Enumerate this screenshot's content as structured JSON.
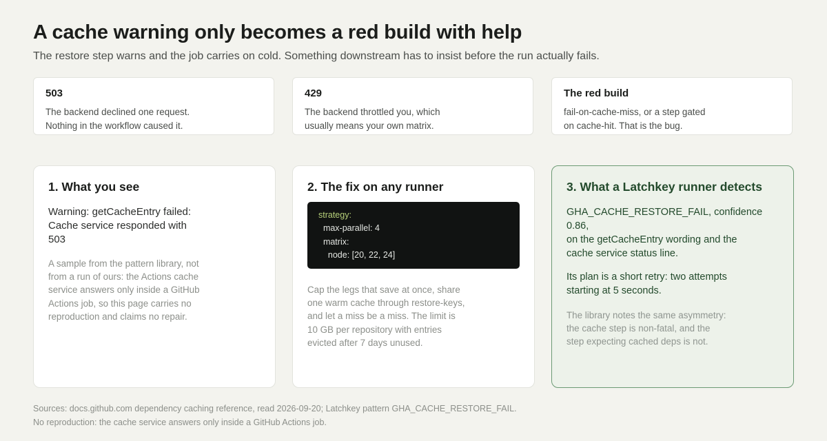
{
  "header": {
    "title": "A cache warning only becomes a red build with help",
    "subtitle": "The restore step warns and the job carries on cold. Something downstream has to insist before the run actually fails."
  },
  "stats": [
    {
      "heading": "503",
      "lines": [
        "The backend declined one request.",
        "Nothing in the workflow caused it."
      ]
    },
    {
      "heading": "429",
      "lines": [
        "The backend throttled you, which",
        "usually means your own matrix."
      ]
    },
    {
      "heading": "The red build",
      "lines": [
        "fail-on-cache-miss, or a step gated",
        "on cache-hit. That is the bug."
      ]
    }
  ],
  "panels": {
    "see": {
      "title": "1. What you see",
      "lines": [
        "Warning: getCacheEntry failed:",
        "Cache service responded with",
        "503"
      ],
      "note": [
        "A sample from the pattern library, not",
        "from a run of ours: the Actions cache",
        "service answers only inside a GitHub",
        "Actions job, so this page carries no",
        "reproduction and claims no repair."
      ]
    },
    "fix": {
      "title": "2. The fix on any runner",
      "code": {
        "key": "strategy:",
        "lines": [
          "  max-parallel: 4",
          "  matrix:",
          "    node: [20, 22, 24]"
        ]
      },
      "note": [
        "Cap the legs that save at once, share",
        "one warm cache through restore-keys,",
        "and let a miss be a miss. The limit is",
        "10 GB per repository with entries",
        "evicted after 7 days unused."
      ]
    },
    "detect": {
      "title": "3. What a Latchkey runner detects",
      "lines": [
        "GHA_CACHE_RESTORE_FAIL, confidence 0.86,",
        "on the getCacheEntry wording and the",
        "cache service status line."
      ],
      "plan": [
        "Its plan is a short retry: two attempts",
        "starting at 5 seconds."
      ],
      "note": [
        "The library notes the same asymmetry:",
        "the cache step is non-fatal, and the",
        "step expecting cached deps is not."
      ]
    }
  },
  "footer": {
    "lines": [
      "Sources: docs.github.com dependency caching reference, read 2026-09-20; Latchkey pattern GHA_CACHE_RESTORE_FAIL.",
      "No reproduction: the cache service answers only inside a GitHub Actions job."
    ]
  },
  "colors": {
    "background": "#f3f3ee",
    "accent_panel": "#edf2ea",
    "accent_border": "#6c9a74",
    "accent_text": "#234a2c",
    "code_background": "#111312",
    "code_key": "#b7d07a"
  }
}
